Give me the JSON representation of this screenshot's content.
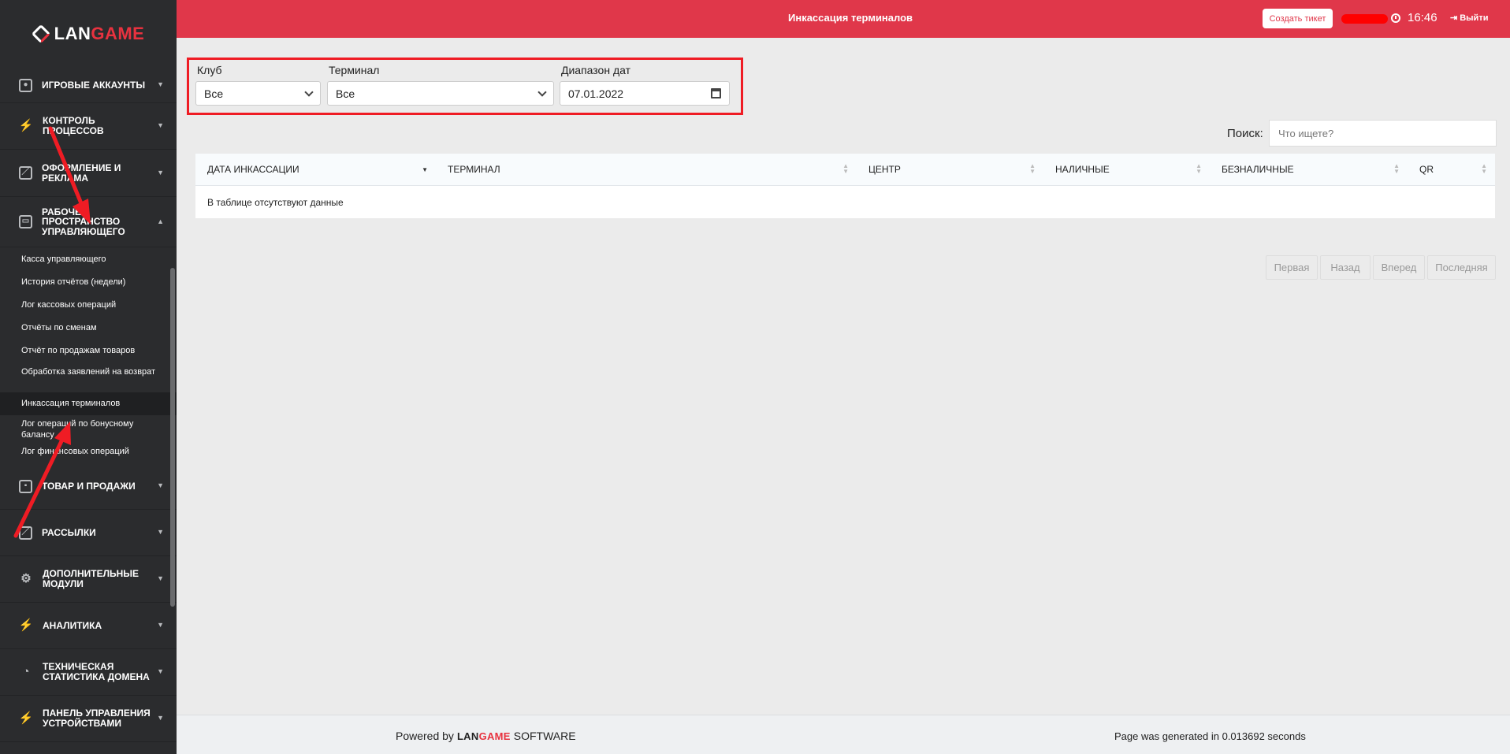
{
  "brand": {
    "logo_text_a": "LAN",
    "logo_text_b": "GAME"
  },
  "header": {
    "title": "Инкассация терминалов",
    "ticket_button": "Создать тикет",
    "time": "16:46",
    "logout": "Выйти"
  },
  "sidebar": {
    "sections": [
      {
        "label": "ИГРОВЫЕ АККАУНТЫ",
        "icon": "account-icon"
      },
      {
        "label": "КОНТРОЛЬ ПРОЦЕССОВ",
        "icon": "bolt-icon"
      },
      {
        "label": "ОФОРМЛЕНИЕ И РЕКЛАМА",
        "icon": "edit-icon"
      },
      {
        "label": "РАБОЧЕЕ ПРОСТРАНСТВО УПРАВЛЯЮЩЕГО",
        "icon": "briefcase-icon",
        "expanded": true
      },
      {
        "label": "ТОВАР И ПРОДАЖИ",
        "icon": "box-icon"
      },
      {
        "label": "РАССЫЛКИ",
        "icon": "edit-icon"
      },
      {
        "label": "ДОПОЛНИТЕЛЬНЫЕ МОДУЛИ",
        "icon": "gear-icon"
      },
      {
        "label": "АНАЛИТИКА",
        "icon": "bolt-icon"
      },
      {
        "label": "ТЕХНИЧЕСКАЯ СТАТИСТИКА ДОМЕНА",
        "icon": "pie-icon"
      },
      {
        "label": "ПАНЕЛЬ УПРАВЛЕНИЯ УСТРОЙСТВАМИ",
        "icon": "bolt-icon"
      }
    ],
    "sub_items": [
      "Касса управляющего",
      "История отчётов (недели)",
      "Лог кассовых операций",
      "Отчёты по сменам",
      "Отчёт по продажам товаров",
      "Обработка заявлений на возврат",
      "Инкассация терминалов",
      "Лог операций по бонусному балансу",
      "Лог финансовых операций"
    ],
    "active_sub_item": "Инкассация терминалов"
  },
  "filters": {
    "club_label": "Клуб",
    "club_value": "Все",
    "terminal_label": "Терминал",
    "terminal_value": "Все",
    "date_label": "Диапазон дат",
    "date_value": "07.01.2022"
  },
  "search": {
    "label": "Поиск:",
    "placeholder": "Что ищете?"
  },
  "table": {
    "columns": [
      "ДАТА ИНКАССАЦИИ",
      "ТЕРМИНАЛ",
      "ЦЕНТР",
      "НАЛИЧНЫЕ",
      "БЕЗНАЛИЧНЫЕ",
      "QR"
    ],
    "empty_message": "В таблице отсутствуют данные"
  },
  "pagination": {
    "first": "Первая",
    "prev": "Назад",
    "next": "Вперед",
    "last": "Последняя"
  },
  "footer": {
    "powered_by": "Powered by",
    "brand_a": "LAN",
    "brand_b": "GAME",
    "software": "SOFTWARE",
    "generated": "Page was generated in 0.013692 seconds"
  },
  "colors": {
    "accent": "#e0374a",
    "sidebar_bg": "#2b2c2e",
    "annotation": "#ef1c24"
  }
}
